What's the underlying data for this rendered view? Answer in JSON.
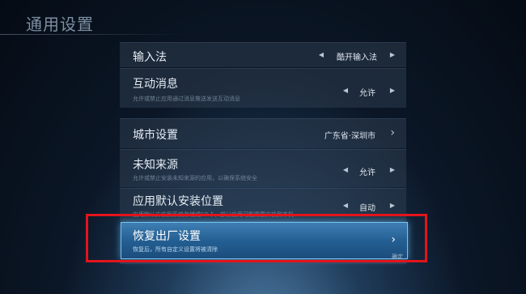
{
  "header": {
    "title": "通用设置"
  },
  "settings": {
    "input_method": {
      "label": "输入法",
      "value": "酷开输入法"
    },
    "interactive_messages": {
      "label": "互动消息",
      "sub": "允许或禁止应用通过消息推送发送互动消息",
      "value": "允许"
    },
    "city": {
      "label": "城市设置",
      "value": "广东省·深圳市"
    },
    "unknown_sources": {
      "label": "未知来源",
      "sub": "允许或禁止安装未知来源的应用，以确保系统安全",
      "value": "允许"
    },
    "install_location": {
      "label": "应用默认安装位置",
      "sub": "应用默认安装到系统存储或SD卡，部分应用可能需要安装到本机",
      "value": "自动"
    },
    "factory_reset": {
      "label": "恢复出厂设置",
      "sub": "恢复后，所有自定义设置将被清除"
    }
  },
  "footer": {
    "text": "确定"
  },
  "colors": {
    "highlight": "#245f93",
    "focus_border": "#79c2f0",
    "annotation_red": "#e3141b"
  },
  "icons": [
    "arrow-left-icon",
    "arrow-right-icon",
    "chevron-right-icon"
  ]
}
